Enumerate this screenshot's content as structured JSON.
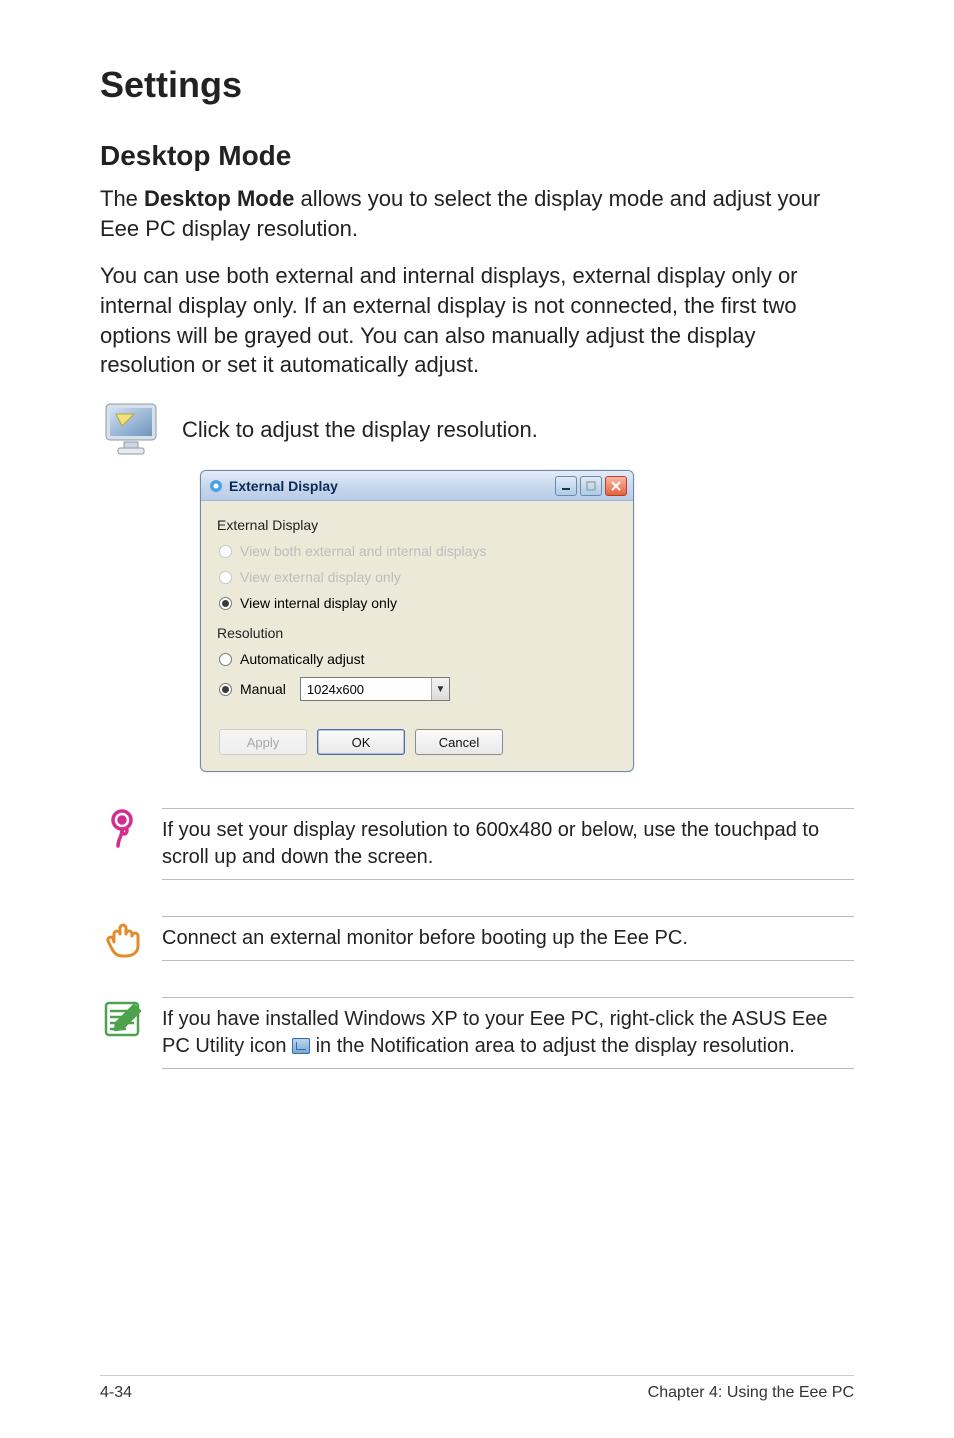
{
  "page": {
    "h1": "Settings",
    "h2": "Desktop Mode",
    "intro_pre": "The ",
    "intro_bold": "Desktop Mode",
    "intro_post": " allows you to select the display mode and adjust your Eee PC display resolution.",
    "para2": "You can use both external and internal displays, external display only or internal display only. If an external display is not connected, the first two options will be grayed out. You can also manually adjust the display resolution or set it automatically adjust.",
    "click_caption": "Click to adjust the display resolution."
  },
  "window": {
    "title": "External Display",
    "group1_title": "External Display",
    "opt_both": "View both external and internal displays",
    "opt_ext": "View external display only",
    "opt_int": "View internal display only",
    "group2_title": "Resolution",
    "opt_auto": "Automatically adjust",
    "opt_manual": "Manual",
    "combo_value": "1024x600",
    "btn_apply": "Apply",
    "btn_ok": "OK",
    "btn_cancel": "Cancel"
  },
  "callouts": {
    "c1": "If you set your display resolution to 600x480 or below, use the touchpad to scroll up and down the screen.",
    "c2": "Connect an external monitor before booting up the Eee PC.",
    "c3a": "If you have installed Windows XP to your Eee PC, right-click the ASUS Eee PC Utility icon ",
    "c3b": " in the Notification area to adjust the display resolution."
  },
  "footer": {
    "left": "4-34",
    "right": "Chapter 4: Using the Eee PC"
  },
  "colors": {
    "tip": "#d22d8f",
    "hand": "#e38a2a",
    "note": "#4da24d"
  }
}
